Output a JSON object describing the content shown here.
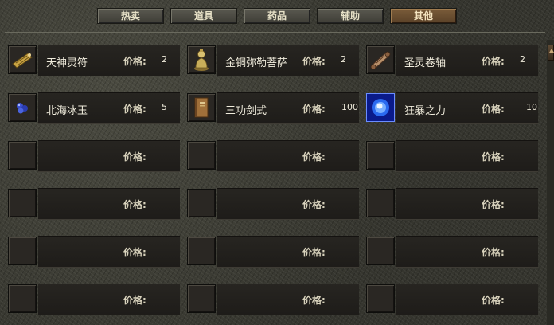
{
  "tabs": [
    {
      "label": "热卖"
    },
    {
      "label": "道具"
    },
    {
      "label": "药品"
    },
    {
      "label": "辅助"
    },
    {
      "label": "其他"
    }
  ],
  "active_tab": "其他",
  "price_label": "价格:",
  "rows": [
    [
      {
        "name": "天神灵符",
        "price": "2",
        "icon": "talisman-icon"
      },
      {
        "name": "金铜弥勒菩萨",
        "price": "2",
        "icon": "buddha-statue-icon"
      },
      {
        "name": "圣灵卷轴",
        "price": "2",
        "icon": "scroll-icon"
      }
    ],
    [
      {
        "name": "北海冰玉",
        "price": "5",
        "icon": "ice-jade-icon"
      },
      {
        "name": "三功剑式",
        "price": "100",
        "icon": "book-icon"
      },
      {
        "name": "狂暴之力",
        "price": "10",
        "icon": "blue-orb-icon"
      }
    ],
    [
      {
        "name": "",
        "price": ""
      },
      {
        "name": "",
        "price": ""
      },
      {
        "name": "",
        "price": ""
      }
    ],
    [
      {
        "name": "",
        "price": ""
      },
      {
        "name": "",
        "price": ""
      },
      {
        "name": "",
        "price": ""
      }
    ],
    [
      {
        "name": "",
        "price": ""
      },
      {
        "name": "",
        "price": ""
      },
      {
        "name": "",
        "price": ""
      }
    ],
    [
      {
        "name": "",
        "price": ""
      },
      {
        "name": "",
        "price": ""
      },
      {
        "name": "",
        "price": ""
      }
    ]
  ]
}
